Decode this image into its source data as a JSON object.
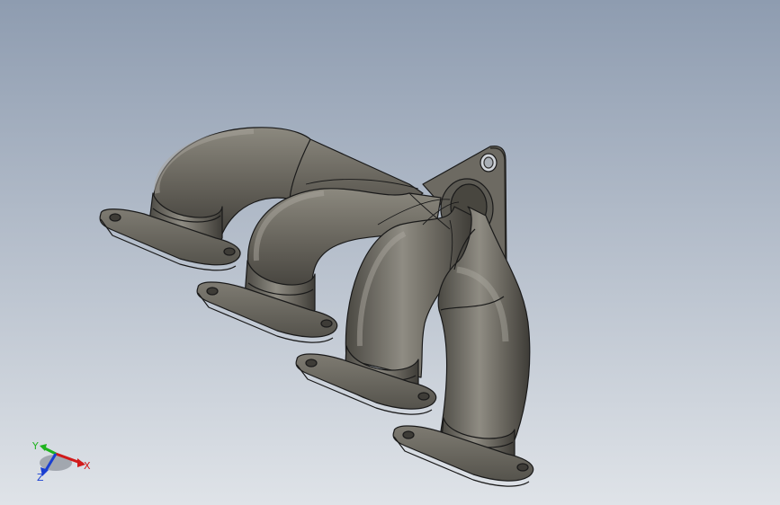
{
  "viewport": {
    "background_top": "#8e9cb0",
    "background_bottom": "#dfe3e8",
    "model": {
      "name": "exhaust-manifest",
      "body_color": "#67645c",
      "edge_color": "#1a1a1a",
      "highlight_color": "#9c998f",
      "shadow_color": "#3a3833"
    }
  },
  "triad": {
    "x_label": "X",
    "y_label": "Y",
    "z_label": "Z",
    "x_color": "#d11a1a",
    "y_color": "#1fb31f",
    "z_color": "#1a3fd1"
  }
}
